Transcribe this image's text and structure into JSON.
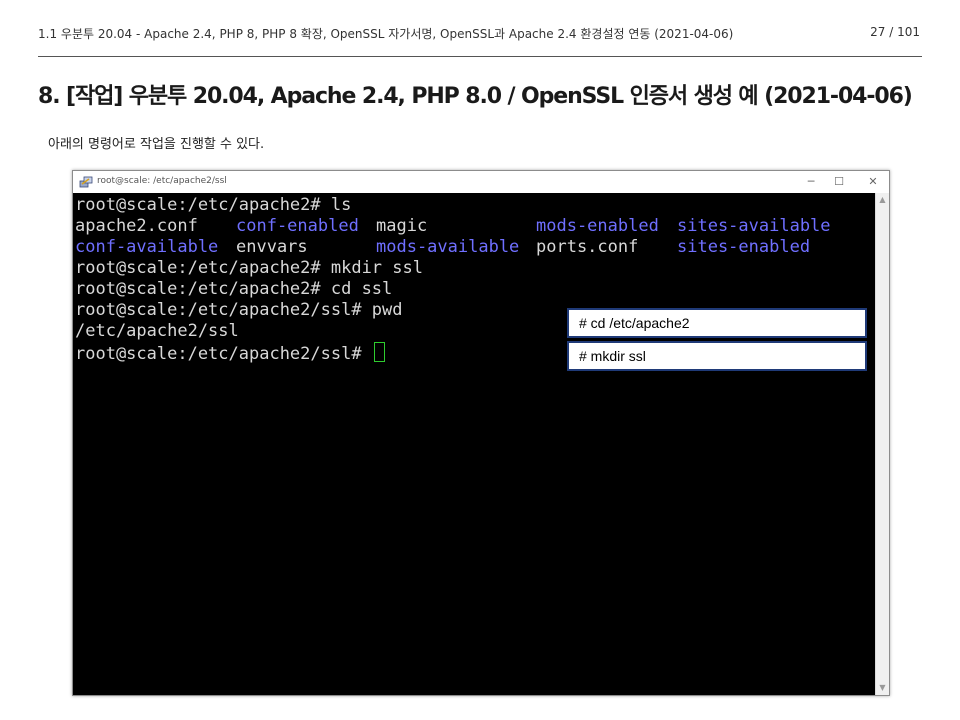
{
  "header": {
    "breadcrumb": "1.1 우분투 20.04 - Apache 2.4, PHP 8, PHP 8 확장, OpenSSL 자가서명, OpenSSL과 Apache 2.4 환경설정 연동 (2021-04-06)",
    "page": "27 / 101"
  },
  "title": "8. [작업] 우분투 20.04, Apache 2.4, PHP 8.0 / OpenSSL 인증서 생성 예 (2021-04-06)",
  "intro": "아래의 명령어로 작업을 진행할 수 있다.",
  "window": {
    "title": "root@scale: /etc/apache2/ssl",
    "minimize": "─",
    "maximize": "☐",
    "close": "✕"
  },
  "terminal": {
    "line1": "root@scale:/etc/apache2# ls",
    "ls_row1": [
      "apache2.conf",
      "conf-enabled",
      "magic",
      "mods-enabled",
      "sites-available"
    ],
    "ls_row2": [
      "conf-available",
      "envvars",
      "mods-available",
      "ports.conf",
      "sites-enabled"
    ],
    "line4": "root@scale:/etc/apache2# mkdir ssl",
    "line5": "root@scale:/etc/apache2# cd ssl",
    "line6": "root@scale:/etc/apache2/ssl# pwd",
    "line7": "/etc/apache2/ssl",
    "line8": "root@scale:/etc/apache2/ssl# "
  },
  "callouts": [
    "# cd /etc/apache2",
    "# mkdir ssl"
  ],
  "colors": {
    "directory": "#6f6fff",
    "text": "#d8d8d8",
    "cursor": "#2ecc2e",
    "callout_border": "#1f3a78"
  }
}
